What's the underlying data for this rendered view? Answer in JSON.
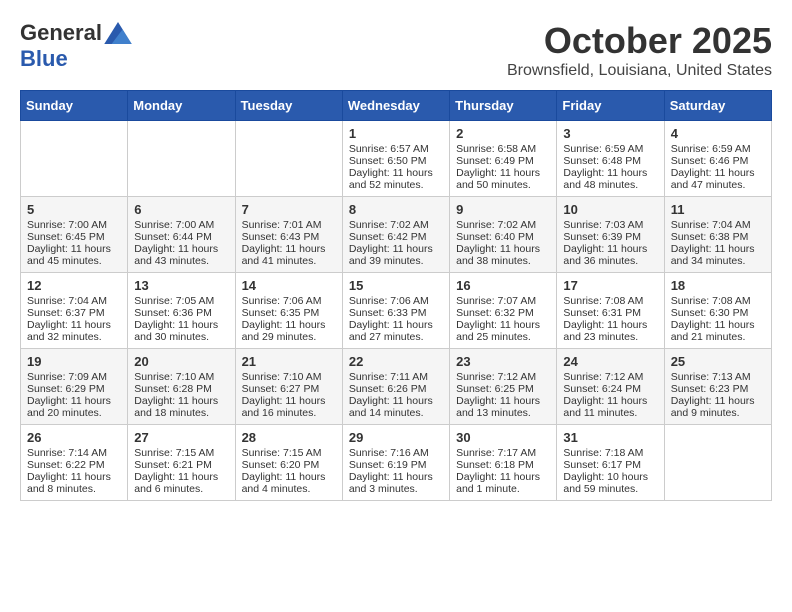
{
  "header": {
    "logo_general": "General",
    "logo_blue": "Blue",
    "month_title": "October 2025",
    "location": "Brownsfield, Louisiana, United States"
  },
  "days_of_week": [
    "Sunday",
    "Monday",
    "Tuesday",
    "Wednesday",
    "Thursday",
    "Friday",
    "Saturday"
  ],
  "weeks": [
    [
      {
        "day": "",
        "data": ""
      },
      {
        "day": "",
        "data": ""
      },
      {
        "day": "",
        "data": ""
      },
      {
        "day": "1",
        "data": "Sunrise: 6:57 AM\nSunset: 6:50 PM\nDaylight: 11 hours and 52 minutes."
      },
      {
        "day": "2",
        "data": "Sunrise: 6:58 AM\nSunset: 6:49 PM\nDaylight: 11 hours and 50 minutes."
      },
      {
        "day": "3",
        "data": "Sunrise: 6:59 AM\nSunset: 6:48 PM\nDaylight: 11 hours and 48 minutes."
      },
      {
        "day": "4",
        "data": "Sunrise: 6:59 AM\nSunset: 6:46 PM\nDaylight: 11 hours and 47 minutes."
      }
    ],
    [
      {
        "day": "5",
        "data": "Sunrise: 7:00 AM\nSunset: 6:45 PM\nDaylight: 11 hours and 45 minutes."
      },
      {
        "day": "6",
        "data": "Sunrise: 7:00 AM\nSunset: 6:44 PM\nDaylight: 11 hours and 43 minutes."
      },
      {
        "day": "7",
        "data": "Sunrise: 7:01 AM\nSunset: 6:43 PM\nDaylight: 11 hours and 41 minutes."
      },
      {
        "day": "8",
        "data": "Sunrise: 7:02 AM\nSunset: 6:42 PM\nDaylight: 11 hours and 39 minutes."
      },
      {
        "day": "9",
        "data": "Sunrise: 7:02 AM\nSunset: 6:40 PM\nDaylight: 11 hours and 38 minutes."
      },
      {
        "day": "10",
        "data": "Sunrise: 7:03 AM\nSunset: 6:39 PM\nDaylight: 11 hours and 36 minutes."
      },
      {
        "day": "11",
        "data": "Sunrise: 7:04 AM\nSunset: 6:38 PM\nDaylight: 11 hours and 34 minutes."
      }
    ],
    [
      {
        "day": "12",
        "data": "Sunrise: 7:04 AM\nSunset: 6:37 PM\nDaylight: 11 hours and 32 minutes."
      },
      {
        "day": "13",
        "data": "Sunrise: 7:05 AM\nSunset: 6:36 PM\nDaylight: 11 hours and 30 minutes."
      },
      {
        "day": "14",
        "data": "Sunrise: 7:06 AM\nSunset: 6:35 PM\nDaylight: 11 hours and 29 minutes."
      },
      {
        "day": "15",
        "data": "Sunrise: 7:06 AM\nSunset: 6:33 PM\nDaylight: 11 hours and 27 minutes."
      },
      {
        "day": "16",
        "data": "Sunrise: 7:07 AM\nSunset: 6:32 PM\nDaylight: 11 hours and 25 minutes."
      },
      {
        "day": "17",
        "data": "Sunrise: 7:08 AM\nSunset: 6:31 PM\nDaylight: 11 hours and 23 minutes."
      },
      {
        "day": "18",
        "data": "Sunrise: 7:08 AM\nSunset: 6:30 PM\nDaylight: 11 hours and 21 minutes."
      }
    ],
    [
      {
        "day": "19",
        "data": "Sunrise: 7:09 AM\nSunset: 6:29 PM\nDaylight: 11 hours and 20 minutes."
      },
      {
        "day": "20",
        "data": "Sunrise: 7:10 AM\nSunset: 6:28 PM\nDaylight: 11 hours and 18 minutes."
      },
      {
        "day": "21",
        "data": "Sunrise: 7:10 AM\nSunset: 6:27 PM\nDaylight: 11 hours and 16 minutes."
      },
      {
        "day": "22",
        "data": "Sunrise: 7:11 AM\nSunset: 6:26 PM\nDaylight: 11 hours and 14 minutes."
      },
      {
        "day": "23",
        "data": "Sunrise: 7:12 AM\nSunset: 6:25 PM\nDaylight: 11 hours and 13 minutes."
      },
      {
        "day": "24",
        "data": "Sunrise: 7:12 AM\nSunset: 6:24 PM\nDaylight: 11 hours and 11 minutes."
      },
      {
        "day": "25",
        "data": "Sunrise: 7:13 AM\nSunset: 6:23 PM\nDaylight: 11 hours and 9 minutes."
      }
    ],
    [
      {
        "day": "26",
        "data": "Sunrise: 7:14 AM\nSunset: 6:22 PM\nDaylight: 11 hours and 8 minutes."
      },
      {
        "day": "27",
        "data": "Sunrise: 7:15 AM\nSunset: 6:21 PM\nDaylight: 11 hours and 6 minutes."
      },
      {
        "day": "28",
        "data": "Sunrise: 7:15 AM\nSunset: 6:20 PM\nDaylight: 11 hours and 4 minutes."
      },
      {
        "day": "29",
        "data": "Sunrise: 7:16 AM\nSunset: 6:19 PM\nDaylight: 11 hours and 3 minutes."
      },
      {
        "day": "30",
        "data": "Sunrise: 7:17 AM\nSunset: 6:18 PM\nDaylight: 11 hours and 1 minute."
      },
      {
        "day": "31",
        "data": "Sunrise: 7:18 AM\nSunset: 6:17 PM\nDaylight: 10 hours and 59 minutes."
      },
      {
        "day": "",
        "data": ""
      }
    ]
  ]
}
